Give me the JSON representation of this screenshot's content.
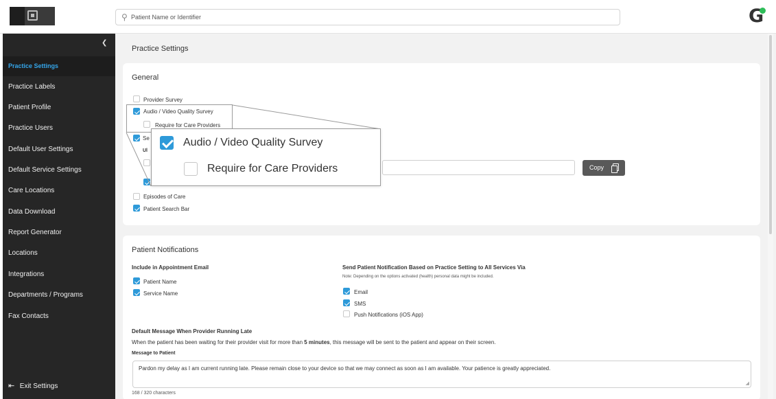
{
  "search": {
    "placeholder": "Patient Name or Identifier"
  },
  "sidebar": {
    "collapse_icon": "chevron-left-icon",
    "items": [
      {
        "label": "Practice Settings",
        "active": true
      },
      {
        "label": "Practice Labels"
      },
      {
        "label": "Patient Profile"
      },
      {
        "label": "Practice Users"
      },
      {
        "label": "Default User Settings"
      },
      {
        "label": "Default Service Settings"
      },
      {
        "label": "Care Locations"
      },
      {
        "label": "Data Download"
      },
      {
        "label": "Report Generator"
      },
      {
        "label": "Locations"
      },
      {
        "label": "Integrations"
      },
      {
        "label": "Departments / Programs"
      },
      {
        "label": "Fax Contacts"
      }
    ],
    "exit_label": "Exit Settings"
  },
  "page": {
    "title": "Practice Settings"
  },
  "general": {
    "title": "General",
    "provider_survey": {
      "label": "Provider Survey",
      "checked": false
    },
    "av_survey": {
      "label": "Audio / Video Quality Survey",
      "checked": true
    },
    "require_care_providers": {
      "label": "Require for Care Providers",
      "checked": false
    },
    "partial_se": "Se",
    "partial_ul": "Ul",
    "copy_label": "Copy",
    "episodes_of_care": {
      "label": "Episodes of Care",
      "checked": false
    },
    "patient_search_bar": {
      "label": "Patient Search Bar",
      "checked": true
    }
  },
  "zoom": {
    "av_survey": "Audio / Video Quality Survey",
    "require_care_providers": "Require for Care Providers"
  },
  "notifications": {
    "title": "Patient Notifications",
    "include_heading": "Include in Appointment Email",
    "patient_name": {
      "label": "Patient Name",
      "checked": true
    },
    "service_name": {
      "label": "Service Name",
      "checked": true
    },
    "send_heading": "Send Patient Notification Based on Practice Setting to All Services Via",
    "send_note": "Note: Depending on the options activated (health) personal data might be included.",
    "email": {
      "label": "Email",
      "checked": true
    },
    "sms": {
      "label": "SMS",
      "checked": true
    },
    "push": {
      "label": "Push Notifications (iOS App)",
      "checked": false
    },
    "running_late_heading": "Default Message When Provider Running Late",
    "running_late_text_a": "When the patient has been waiting for their provider visit for more than ",
    "running_late_text_bold": "5 minutes",
    "running_late_text_b": ", this message will be sent to the patient and appear on their screen.",
    "message_label": "Message to Patient",
    "message_value": "Pardon my delay as I am current running late. Please remain close to your device so that we may connect as soon as I am available. Your patience is greatly appreciated.",
    "char_count": "168 / 320 characters"
  },
  "colors": {
    "accent": "#2e9ad9",
    "sidebar_bg": "#262626",
    "active_text": "#35a6ea",
    "status_dot": "#2ebd59"
  }
}
